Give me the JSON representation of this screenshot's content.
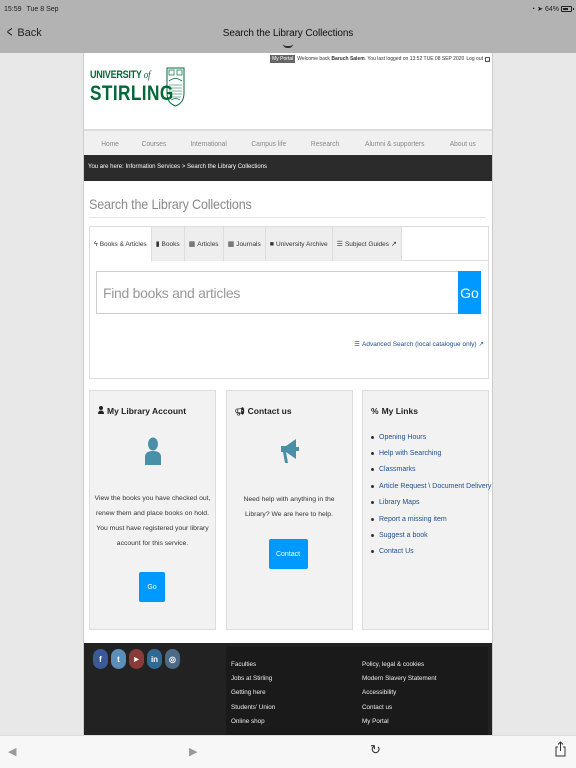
{
  "status_bar": {
    "time": "15:59",
    "date": "Tue 8 Sep",
    "battery": "64%"
  },
  "nav_bar": {
    "back_label": "Back",
    "title": "Search the Library Collections"
  },
  "portal_bar": {
    "portal_label": "My Portal",
    "welcome_prefix": "Welcome back",
    "user_name": "Baruch Salem",
    "last_login": ". You last logged on 13:52 TUE 08 SEP 2020",
    "logout_label": "Log out"
  },
  "logo": {
    "line1": "UNIVERSITY",
    "line1_of": "of",
    "line2": "STIRLING"
  },
  "main_nav": [
    "Home",
    "Courses",
    "International",
    "Campus life",
    "Research",
    "Alumni & supporters",
    "About us"
  ],
  "breadcrumb": "You are here: Information Services > Search the Library Collections",
  "page_title": "Search the Library Collections",
  "search": {
    "tabs": [
      {
        "label": "Books & Articles",
        "icon": "bolt-icon",
        "active": true
      },
      {
        "label": "Books",
        "icon": "book-icon",
        "active": false
      },
      {
        "label": "Articles",
        "icon": "newspaper-icon",
        "active": false
      },
      {
        "label": "Journals",
        "icon": "newspaper-icon",
        "active": false
      },
      {
        "label": "University Archive",
        "icon": "archive-icon",
        "active": false
      },
      {
        "label": "Subject Guides",
        "icon": "list-icon",
        "active": false
      }
    ],
    "placeholder": "Find books and articles",
    "value": "",
    "go_label": "Go",
    "advanced_label": "Advanced Search (local catalogue only)"
  },
  "cards": {
    "account": {
      "title": "My Library Account",
      "text": "View the books you have checked out, renew them and place books on hold. You must have registered your library account for this service.",
      "button": "Go"
    },
    "contact": {
      "title": "Contact us",
      "text": "Need help with anything in the Library? We are here to help.",
      "button": "Contact"
    },
    "links": {
      "title": "My Links",
      "items": [
        "Opening Hours",
        "Help with Searching",
        "Classmarks",
        "Article Request \\ Document Delivery",
        "Library Maps",
        "Report a missing item",
        "Suggest a book",
        "Contact Us"
      ]
    }
  },
  "footer": {
    "socials": [
      {
        "name": "facebook",
        "glyph": "f",
        "color": "#3b5998"
      },
      {
        "name": "twitter",
        "glyph": "t",
        "color": "#5b8fb9"
      },
      {
        "name": "youtube",
        "glyph": "▶",
        "color": "#8b3a3a"
      },
      {
        "name": "linkedin",
        "glyph": "in",
        "color": "#2e6a94"
      },
      {
        "name": "instagram",
        "glyph": "◎",
        "color": "#4a6a85"
      }
    ],
    "col1": [
      "Faculties",
      "Jobs at Stirling",
      "Getting here",
      "Students' Union",
      "Online shop"
    ],
    "col2": [
      "Policy, legal & cookies",
      "Modern Slavery Statement",
      "Accessibility",
      "Contact us",
      "My Portal"
    ]
  },
  "colors": {
    "brand_green": "#006938",
    "accent_blue": "#0099ff",
    "link_blue": "#1f4e8c",
    "icon_teal": "#4a8fa8"
  }
}
